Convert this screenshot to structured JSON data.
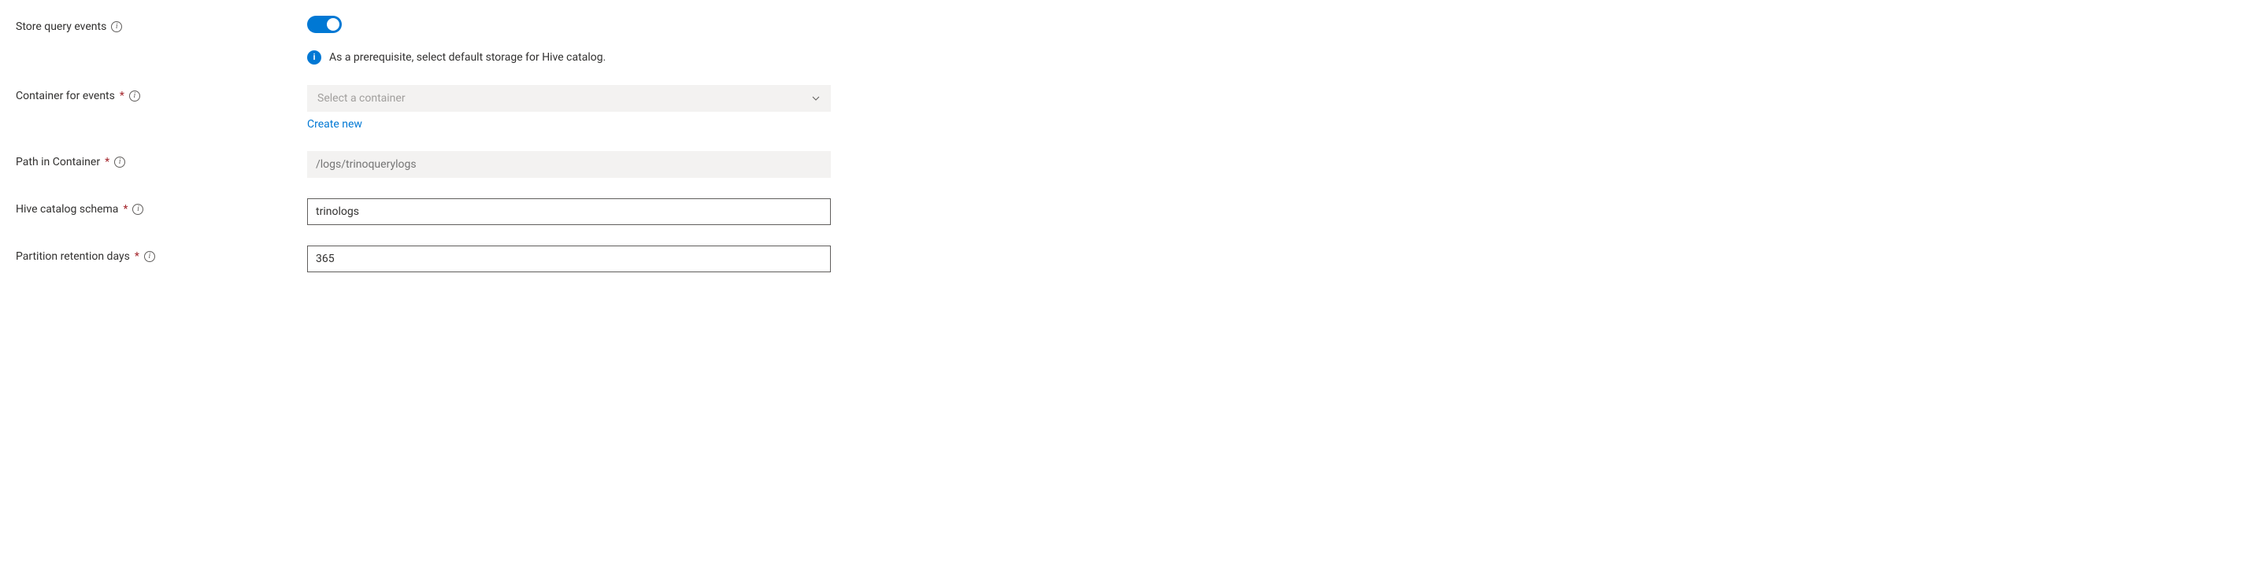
{
  "fields": {
    "store_query_events": {
      "label": "Store query events",
      "toggle_on": true,
      "info_message": "As a prerequisite, select default storage for Hive catalog."
    },
    "container_for_events": {
      "label": "Container for events",
      "required_marker": "*",
      "placeholder": "Select a container",
      "create_new_label": "Create new"
    },
    "path_in_container": {
      "label": "Path in Container",
      "required_marker": "*",
      "placeholder": "/logs/trinoquerylogs",
      "value": ""
    },
    "hive_catalog_schema": {
      "label": "Hive catalog schema",
      "required_marker": "*",
      "value": "trinologs"
    },
    "partition_retention_days": {
      "label": "Partition retention days",
      "required_marker": "*",
      "value": "365"
    }
  }
}
